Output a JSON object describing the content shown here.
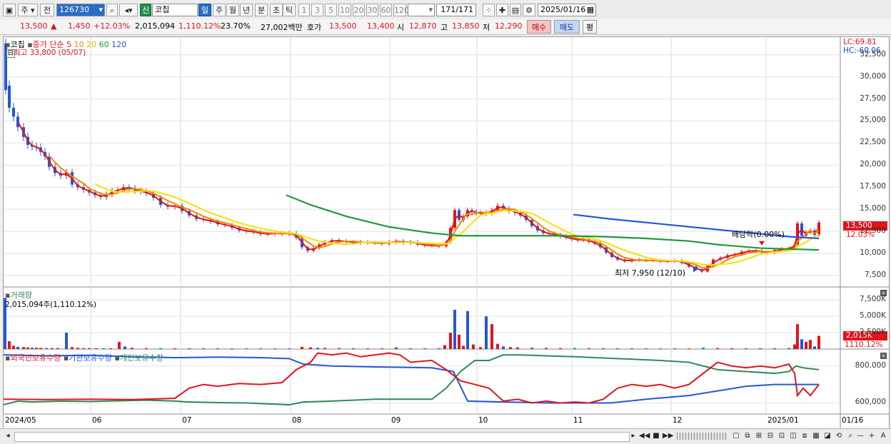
{
  "toolbar": {
    "type1": "주",
    "type2": "전",
    "code": "126730",
    "badge": "신",
    "name": "코칩",
    "periods": [
      "일",
      "주",
      "월",
      "년",
      "분",
      "초",
      "틱"
    ],
    "intervals": [
      "1",
      "3",
      "5",
      "10",
      "20",
      "30",
      "60",
      "120"
    ],
    "count": "171",
    "count_total": "/171",
    "date": "2025/01/16"
  },
  "quote": {
    "price": "13,500",
    "change_arrow": "▲",
    "change": "1,450",
    "change_pct": "+12.03%",
    "volume": "2,015,094",
    "volume_pct": "1,110.12%",
    "turnover": "23.70%",
    "amount": "27,002백만",
    "bid_label": "호가",
    "ask": "13,500",
    "bid": "13,400",
    "open_label": "시",
    "open": "12,870",
    "high_label": "고",
    "high": "13,850",
    "low_label": "저",
    "low": "12,290",
    "buy": "매수",
    "sell": "매도",
    "eval": "평"
  },
  "price_panel": {
    "name": "코칩",
    "ma_label": "종가 단순",
    "ma_periods": [
      "5",
      "10",
      "20",
      "60",
      "120"
    ],
    "ma_colors": [
      "#e1141c",
      "#f08a00",
      "#f5e11a",
      "#1f9a3a",
      "#2456d8"
    ],
    "high_note": "최고 33,800 (05/07)",
    "low_note": "최저 7,950 (12/10)",
    "dividend_note": "배당락(0.00%)",
    "lc": "LC:69.81",
    "hc": "HC:-60.06",
    "ticks": [
      "32,500",
      "30,000",
      "27,500",
      "25,000",
      "22,500",
      "20,000",
      "17,500",
      "15,000",
      "12,500",
      "10,000",
      "7,500"
    ],
    "tick_values": [
      32500,
      30000,
      27500,
      25000,
      22500,
      20000,
      17500,
      15000,
      12500,
      10000,
      7500
    ],
    "last_price": "13,500",
    "last_pct": "12.03%"
  },
  "volume_panel": {
    "title": "거래량",
    "current": "2,015,094주(1,110.12%)",
    "ticks": [
      "7,500K",
      "5,000K",
      "2,500K"
    ],
    "tick_values": [
      7500,
      5000,
      2500
    ],
    "last": "2,015K",
    "last_pct": "1110.12%"
  },
  "holding_panel": {
    "series": [
      "외국인보유수량",
      "기관보유수량",
      "개인보유수량"
    ],
    "colors": [
      "#e1141c",
      "#2456d8",
      "#2e8b57"
    ],
    "ticks": [
      "800,000",
      "600,000"
    ],
    "tick_values": [
      800000,
      600000
    ]
  },
  "xaxis": [
    "2024/05",
    "06",
    "07",
    "08",
    "09",
    "10",
    "11",
    "12",
    "2025/01",
    "01/16"
  ],
  "chart_data": {
    "type": "candlestick",
    "title": "코칩",
    "x": [
      "2024/05",
      "06",
      "07",
      "08",
      "09",
      "10",
      "11",
      "12",
      "2025/01",
      "01/16"
    ],
    "close_approx": [
      33800,
      17500,
      13000,
      10500,
      11000,
      15000,
      12000,
      7950,
      10500,
      13500
    ],
    "volume_approx_k": [
      7800,
      2500,
      400,
      300,
      200,
      6000,
      400,
      200,
      3800,
      2015
    ]
  }
}
